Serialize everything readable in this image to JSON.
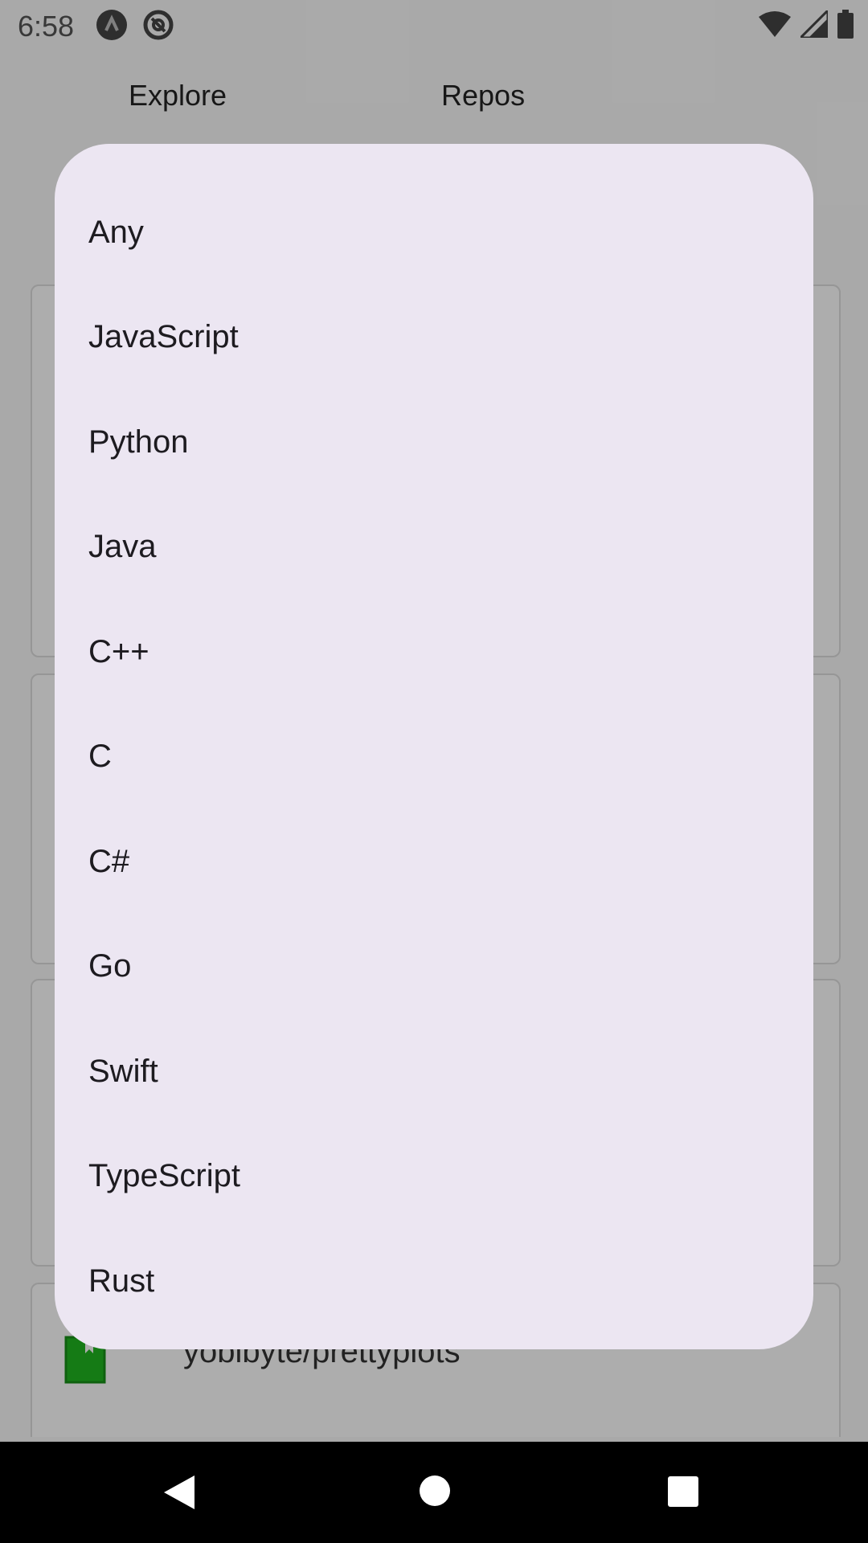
{
  "status_bar": {
    "time": "6:58",
    "icons": [
      "app-a-icon",
      "app-at-icon",
      "wifi-icon",
      "signal-icon",
      "battery-icon"
    ]
  },
  "tabs": [
    {
      "label": "Explore"
    },
    {
      "label": "Repos"
    }
  ],
  "background": {
    "visible_repo_name": "yobibyte/prettyplots"
  },
  "language_dialog": {
    "options": [
      "Any",
      "JavaScript",
      "Python",
      "Java",
      "C++",
      "C",
      "C#",
      "Go",
      "Swift",
      "TypeScript",
      "Rust"
    ]
  },
  "nav_bar": {
    "icons": [
      "back-icon",
      "home-icon",
      "recents-icon"
    ]
  },
  "colors": {
    "dialog_bg": "#ece6f2",
    "scrim": "rgba(0,0,0,0.32)",
    "repo_icon": "#1fb51f"
  }
}
